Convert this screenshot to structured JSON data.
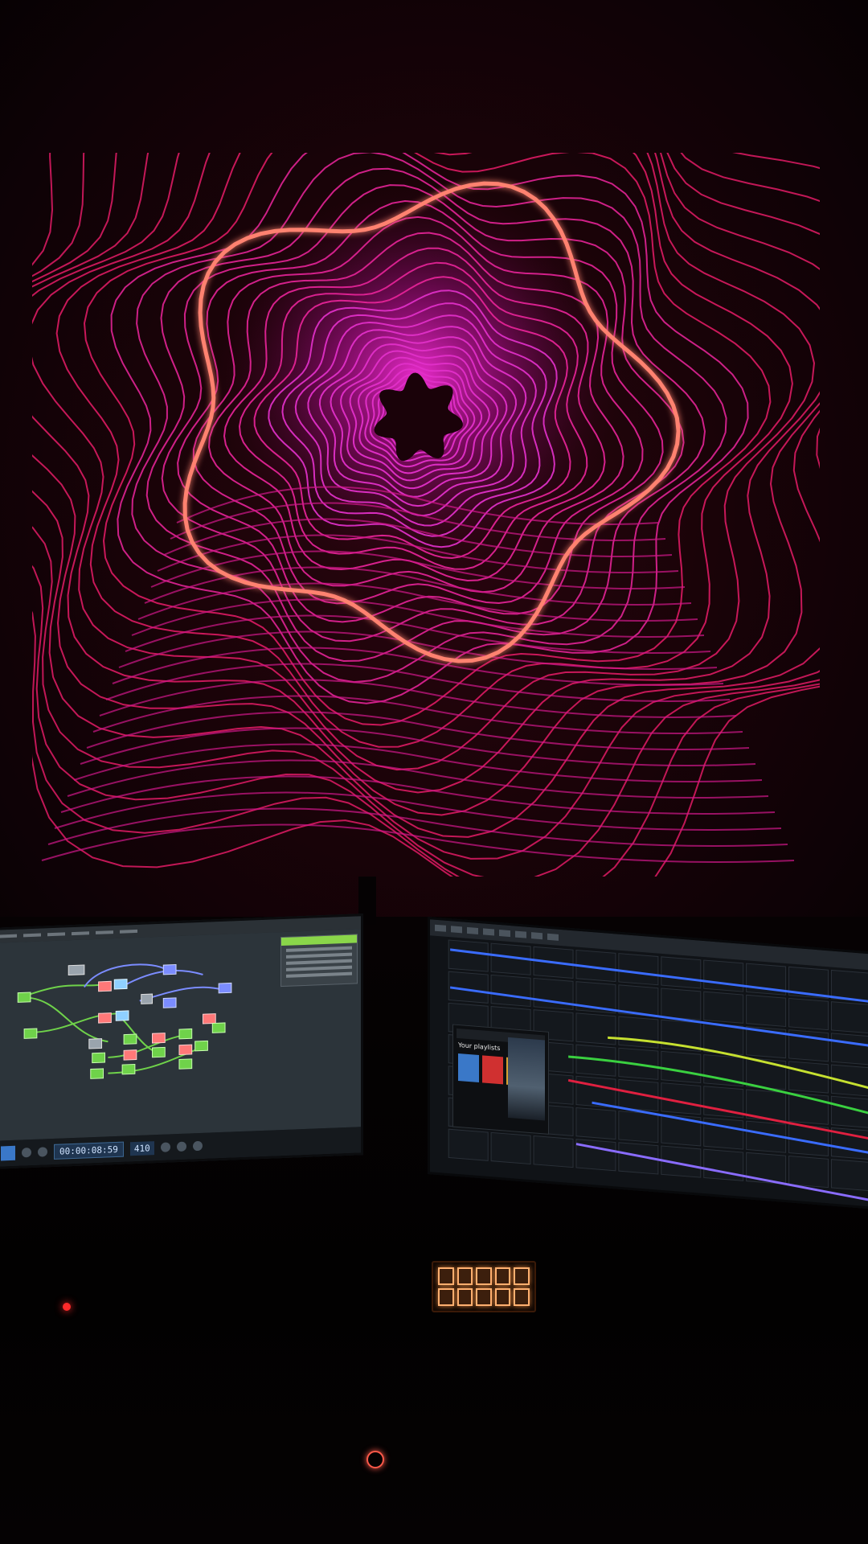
{
  "scene": {
    "colors": {
      "wall": "#1a0308",
      "projection_lines": "#e0207a",
      "projection_core": "#d020c0",
      "highlight_line": "#ff7a6a",
      "controller_pads": "#ffb070",
      "node_green": "#6fd24a",
      "node_blue": "#7b8cff"
    },
    "left_monitor": {
      "timecode": "00:00:08:59",
      "frame": "410"
    },
    "right_monitor": {
      "popup_title": "Your playlists"
    }
  }
}
